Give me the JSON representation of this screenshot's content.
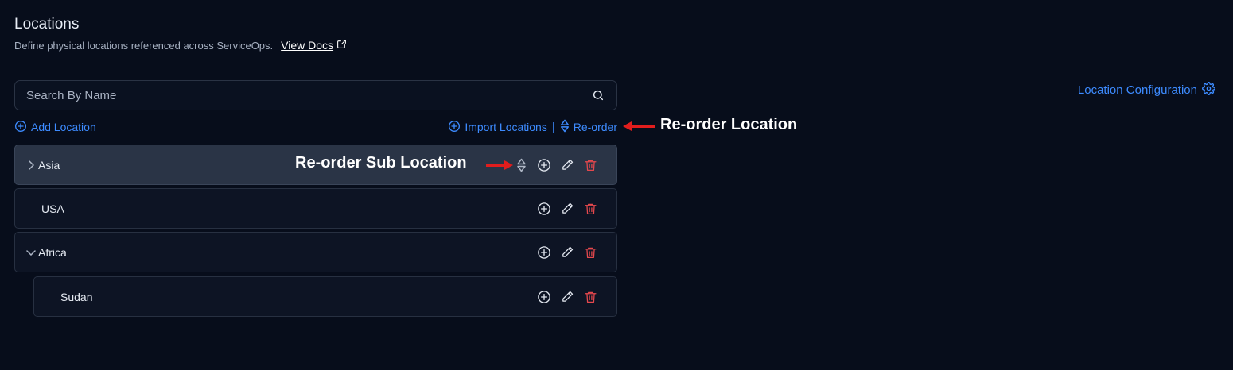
{
  "header": {
    "title": "Locations",
    "subtitle": "Define physical locations referenced across ServiceOps.",
    "docs_label": "View Docs"
  },
  "search": {
    "placeholder": "Search By Name",
    "value": ""
  },
  "config_label": "Location Configuration",
  "toolbar": {
    "add_label": "Add Location",
    "import_label": "Import Locations",
    "separator": "|",
    "reorder_label": "Re-order"
  },
  "annotations": {
    "reorder_location": "Re-order Location",
    "reorder_sub_location": "Re-order Sub Location"
  },
  "locations": [
    {
      "name": "Asia",
      "expander": "collapsed"
    },
    {
      "name": "USA",
      "expander": "none"
    },
    {
      "name": "Africa",
      "expander": "expanded"
    },
    {
      "name": "Sudan",
      "expander": "none",
      "parent": "Africa"
    }
  ],
  "colors": {
    "background": "#070d1b",
    "accent": "#3d8bff",
    "danger": "#e5484d",
    "annotation_arrow": "#e11d1d"
  },
  "icons": {
    "search": "search-icon",
    "external": "external-link-icon",
    "settings": "gear-icon",
    "add": "plus-circle-icon",
    "reorder": "reorder-icon",
    "edit": "pencil-icon",
    "delete": "trash-icon"
  }
}
